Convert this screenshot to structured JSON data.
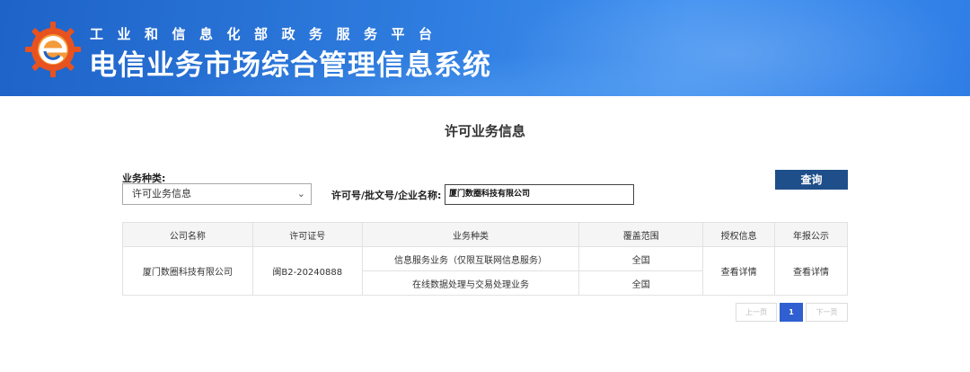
{
  "header": {
    "subtitle": "工业和信息化部政务服务平台",
    "title": "电信业务市场综合管理信息系统"
  },
  "page_title": "许可业务信息",
  "search": {
    "type_label": "业务种类:",
    "type_value": "许可业务信息",
    "name_label": "许可号/批文号/企业名称:",
    "name_value": "厦门数圈科技有限公司",
    "query_button": "查询"
  },
  "table": {
    "headers": [
      "公司名称",
      "许可证号",
      "业务种类",
      "覆盖范围",
      "授权信息",
      "年报公示"
    ],
    "company": "厦门数圈科技有限公司",
    "license_no": "闽B2-20240888",
    "services": [
      {
        "type": "信息服务业务（仅限互联网信息服务）",
        "scope": "全国"
      },
      {
        "type": "在线数据处理与交易处理业务",
        "scope": "全国"
      }
    ],
    "auth_link": "查看详情",
    "report_link": "查看详情"
  },
  "pagination": {
    "prev": "上一页",
    "current": "1",
    "next": "下一页"
  },
  "colors": {
    "banner": "#2f7de0",
    "query_button": "#1f4f8a",
    "page_active": "#2f5fd0"
  }
}
